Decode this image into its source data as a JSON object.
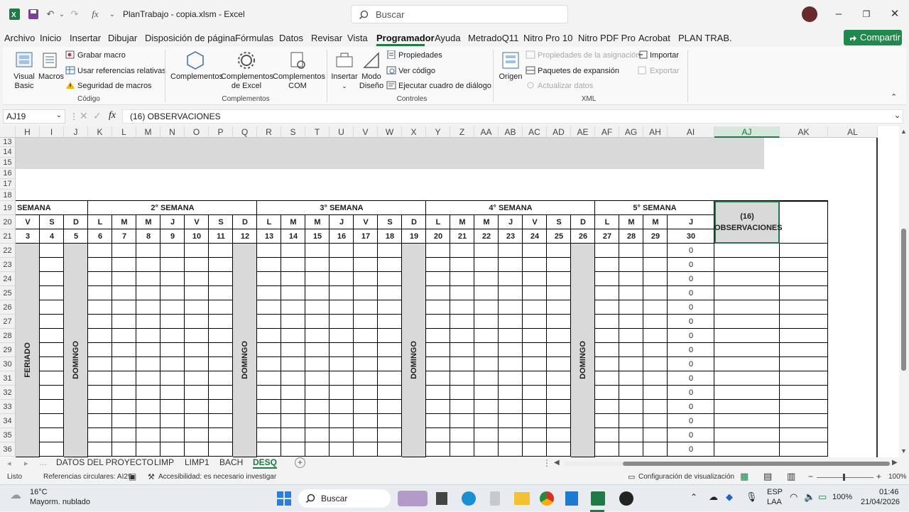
{
  "window": {
    "file_title": "PlanTrabajo - copia.xlsm  -  Excel",
    "search_placeholder": "Buscar",
    "fx_label": "fx"
  },
  "menu": {
    "tabs": [
      "Archivo",
      "Inicio",
      "Insertar",
      "Dibujar",
      "Disposición de página",
      "Fórmulas",
      "Datos",
      "Revisar",
      "Vista",
      "Programador",
      "Ayuda",
      "MetradoQ11",
      "Nitro Pro 10",
      "Nitro PDF Pro",
      "Acrobat",
      "PLAN TRAB."
    ],
    "active": "Programador",
    "share_label": "Compartir"
  },
  "ribbon": {
    "codigo": {
      "visual_basic": "Visual Basic",
      "macros": "Macros",
      "grabar_macro": "Grabar macro",
      "usar_referencias": "Usar referencias relativas",
      "seguridad": "Seguridad de macros",
      "label": "Código"
    },
    "complementos": {
      "complementos": "Complementos",
      "complementos_excel": "Complementos de Excel",
      "complementos_com": "Complementos COM",
      "label": "Complementos"
    },
    "controles": {
      "insertar": "Insertar",
      "modo_diseno": "Modo Diseño",
      "propiedades": "Propiedades",
      "ver_codigo": "Ver código",
      "ejecutar": "Ejecutar cuadro de diálogo",
      "label": "Controles"
    },
    "xml": {
      "origen": "Origen",
      "prop_asignacion": "Propiedades de la asignación",
      "paquetes": "Paquetes de expansión",
      "actualizar": "Actualizar datos",
      "importar": "Importar",
      "exportar": "Exportar",
      "label": "XML"
    }
  },
  "formula_bar": {
    "name_box": "AJ19",
    "formula": "(16) OBSERVACIONES"
  },
  "grid": {
    "columns": [
      "H",
      "I",
      "J",
      "K",
      "L",
      "M",
      "N",
      "O",
      "P",
      "Q",
      "R",
      "S",
      "T",
      "U",
      "V",
      "W",
      "X",
      "Y",
      "Z",
      "AA",
      "AB",
      "AC",
      "AD",
      "AE",
      "AF",
      "AG",
      "AH",
      "AI",
      "AJ",
      "AK",
      "AL"
    ],
    "selected_column": "AJ",
    "rows": [
      "13",
      "14",
      "15",
      "16",
      "17",
      "18",
      "19",
      "20",
      "21",
      "22",
      "23",
      "24",
      "25",
      "26",
      "27",
      "28",
      "29",
      "30",
      "31",
      "32",
      "33",
      "34",
      "35",
      "36"
    ],
    "week_headers": [
      "SEMANA",
      "2° SEMANA",
      "3° SEMANA",
      "4° SEMANA",
      "5° SEMANA"
    ],
    "day_letters": [
      "V",
      "S",
      "D",
      "L",
      "M",
      "M",
      "J",
      "V",
      "S",
      "D",
      "L",
      "M",
      "M",
      "J",
      "V",
      "S",
      "D",
      "L",
      "M",
      "M",
      "J",
      "V",
      "S",
      "D",
      "L",
      "M",
      "M",
      "J"
    ],
    "day_numbers": [
      "3",
      "4",
      "5",
      "6",
      "7",
      "8",
      "9",
      "10",
      "11",
      "12",
      "13",
      "14",
      "15",
      "16",
      "17",
      "18",
      "19",
      "20",
      "21",
      "22",
      "23",
      "24",
      "25",
      "26",
      "27",
      "28",
      "29",
      "30"
    ],
    "obs_number": "(16)",
    "obs_label": "OBSERVACIONES",
    "vertical_labels": [
      "FERIADO",
      "DOMINGO",
      "DOMINGO",
      "DOMINGO",
      "DOMINGO"
    ],
    "zero_value": "0"
  },
  "sheet_tabs": {
    "tabs": [
      "DATOS DEL PROYECTO",
      "LIMP",
      "LIMP1",
      "BACH",
      "DESQ"
    ],
    "active": "DESQ"
  },
  "status": {
    "ready": "Listo",
    "circular": "Referencias circulares: AI29",
    "accessibility": "Accesibilidad: es necesario investigar",
    "view_config": "Configuración de visualización",
    "zoom": "100%"
  },
  "taskbar": {
    "temp": "16°C",
    "weather": "Mayorm. nublado",
    "search": "Buscar",
    "lang1": "ESP",
    "lang2": "LAA",
    "battery": "100%",
    "time": "01:46",
    "date": "21/04/2026"
  },
  "colors": {
    "excel_green": "#1f7a44",
    "header_gray": "#d9d9d9"
  }
}
